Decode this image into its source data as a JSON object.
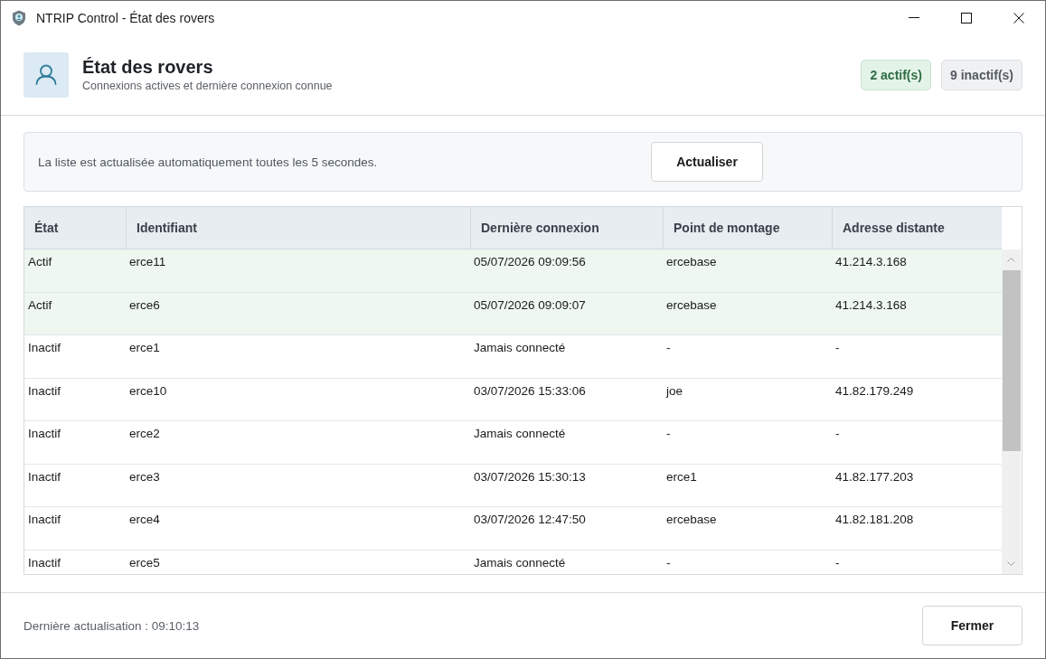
{
  "window": {
    "title": "NTRIP Control - État des rovers"
  },
  "header": {
    "title": "État des rovers",
    "subtitle": "Connexions actives et dernière connexion connue",
    "badges": [
      {
        "kind": "active",
        "label": "2 actif(s)"
      },
      {
        "kind": "inactive",
        "label": "9 inactif(s)"
      }
    ]
  },
  "info_panel": {
    "text": "La liste est actualisée automatiquement toutes les 5 secondes.",
    "button": "Actualiser"
  },
  "table": {
    "columns": [
      "État",
      "Identifiant",
      "Dernière connexion",
      "Point de montage",
      "Adresse distante"
    ],
    "rows": [
      {
        "active": true,
        "cells": [
          "Actif",
          "erce11",
          "05/07/2026 09:09:56",
          "ercebase",
          "41.214.3.168"
        ]
      },
      {
        "active": true,
        "cells": [
          "Actif",
          "erce6",
          "05/07/2026 09:09:07",
          "ercebase",
          "41.214.3.168"
        ]
      },
      {
        "active": false,
        "cells": [
          "Inactif",
          "erce1",
          "Jamais connecté",
          "-",
          "-"
        ]
      },
      {
        "active": false,
        "cells": [
          "Inactif",
          "erce10",
          "03/07/2026 15:33:06",
          "joe",
          "41.82.179.249"
        ]
      },
      {
        "active": false,
        "cells": [
          "Inactif",
          "erce2",
          "Jamais connecté",
          "-",
          "-"
        ]
      },
      {
        "active": false,
        "cells": [
          "Inactif",
          "erce3",
          "03/07/2026 15:30:13",
          "erce1",
          "41.82.177.203"
        ]
      },
      {
        "active": false,
        "cells": [
          "Inactif",
          "erce4",
          "03/07/2026 12:47:50",
          "ercebase",
          "41.82.181.208"
        ]
      },
      {
        "active": false,
        "cells": [
          "Inactif",
          "erce5",
          "Jamais connecté",
          "-",
          "-"
        ]
      }
    ]
  },
  "status_bar": {
    "text": "Dernière actualisation : 09:10:13",
    "button": "Fermer"
  }
}
